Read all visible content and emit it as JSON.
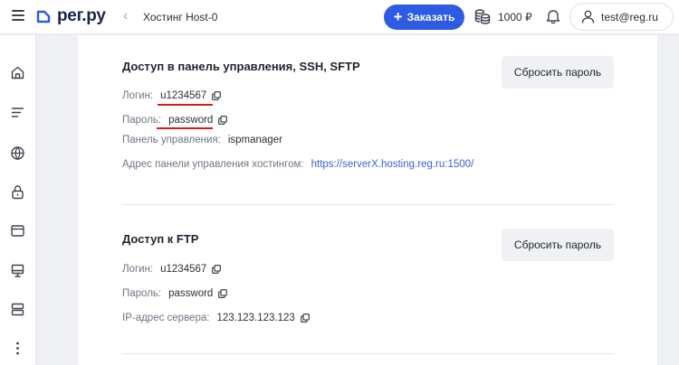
{
  "header": {
    "logo_text": "рег.ру",
    "back_icon": "chevron-left-icon",
    "breadcrumb": "Хостинг Host-0",
    "order_button": "Заказать",
    "balance": "1000 ₽",
    "user_email": "test@reg.ru"
  },
  "sidebar": {
    "icons": [
      "home-icon",
      "list-icon",
      "globe-icon",
      "lock-icon",
      "browser-window-icon",
      "monitor-icon",
      "server-icon",
      "more-vertical-icon"
    ]
  },
  "sections": [
    {
      "title": "Доступ в панель управления, SSH, SFTP",
      "reset_button": "Сбросить пароль",
      "rows": [
        {
          "label": "Логин:",
          "value": "u1234567"
        },
        {
          "label": "Пароль:",
          "value": "password"
        },
        {
          "label": "Панель управления:",
          "value": "ispmanager"
        },
        {
          "label": "Адрес панели управления хостингом:",
          "value": "https://serverX.hosting.reg.ru:1500/"
        }
      ]
    },
    {
      "title": "Доступ к FTP",
      "reset_button": "Сбросить пароль",
      "rows": [
        {
          "label": "Логин:",
          "value": "u1234567"
        },
        {
          "label": "Пароль:",
          "value": "password"
        },
        {
          "label": "IP-адрес сервера:",
          "value": "123.123.123.123"
        }
      ]
    }
  ],
  "colors": {
    "accent": "#2d5be3",
    "link": "#3a63d8",
    "highlight_underline": "#d61b1b",
    "background": "#eef0f3"
  }
}
